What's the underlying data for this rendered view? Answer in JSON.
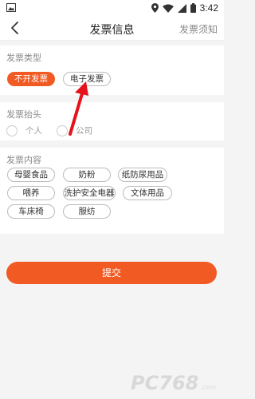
{
  "status_bar": {
    "time": "3:42"
  },
  "app_bar": {
    "title": "发票信息",
    "help": "发票须知"
  },
  "invoice_type": {
    "title": "发票类型",
    "options": [
      "不开发票",
      "电子发票"
    ],
    "selected": "不开发票"
  },
  "invoice_header": {
    "title": "发票抬头",
    "options": [
      "个人",
      "公司"
    ]
  },
  "invoice_content": {
    "title": "发票内容",
    "items": [
      "母婴食品",
      "奶粉",
      "纸防尿用品",
      "喂养",
      "洗护安全电器",
      "文体用品",
      "车床椅",
      "服纺"
    ]
  },
  "submit_label": "提交",
  "watermark": {
    "text": "PC768",
    "suffix": ".com"
  },
  "colors": {
    "accent": "#f15a22",
    "annotation_arrow": "#e5121b"
  }
}
